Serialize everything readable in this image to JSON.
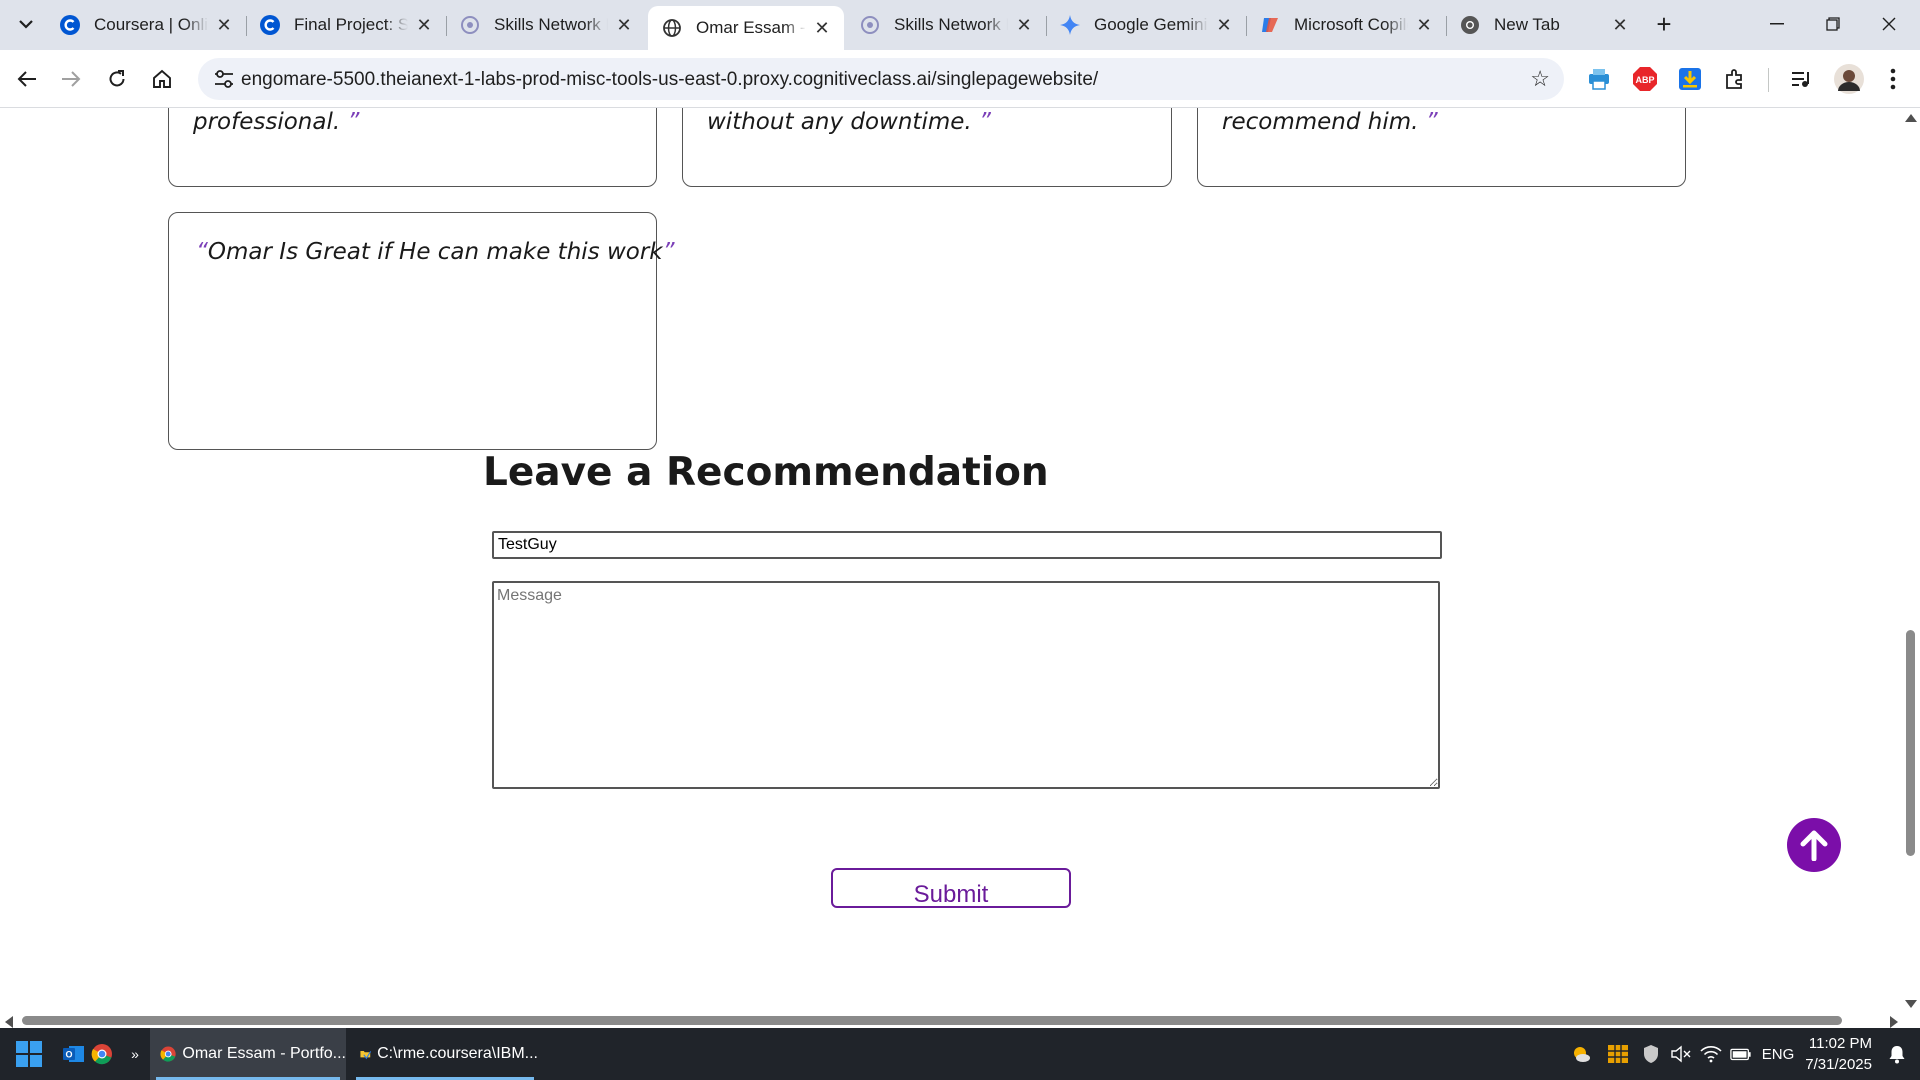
{
  "browser": {
    "tabs": [
      {
        "title": "Coursera | Online Courses",
        "icon": "coursera-icon",
        "active": false
      },
      {
        "title": "Final Project: Submit",
        "icon": "coursera-icon",
        "active": false
      },
      {
        "title": "Skills Network Labs",
        "icon": "skills-network-icon",
        "active": false
      },
      {
        "title": "Omar Essam - Portfolio",
        "icon": "globe-icon",
        "active": true
      },
      {
        "title": "Skills Network Editor",
        "icon": "skills-network-icon",
        "active": false
      },
      {
        "title": "Google Gemini",
        "icon": "gemini-icon",
        "active": false
      },
      {
        "title": "Microsoft Copilot",
        "icon": "copilot-icon",
        "active": false
      },
      {
        "title": "New Tab",
        "icon": "chrome-icon",
        "active": false
      }
    ],
    "url": "engomare-5500.theianext-1-labs-prod-misc-tools-us-east-0.proxy.cognitiveclass.ai/singlepagewebsite/",
    "extensions": [
      "print-extension-icon",
      "adblock-plus-icon",
      "download-extension-icon",
      "extensions-puzzle-icon",
      "media-control-icon",
      "profile-avatar-icon",
      "menu-kebab-icon"
    ]
  },
  "page": {
    "top_quotes": [
      {
        "text": "professional. ",
        "open": "",
        "close": "”"
      },
      {
        "text": "without any downtime. ",
        "open": "",
        "close": "”"
      },
      {
        "text": "recommend him. ",
        "open": "",
        "close": "”"
      }
    ],
    "featured_quote": {
      "open": "“",
      "text": "Omar Is Great if He can make this work",
      "close": "”"
    },
    "section_title": "Leave a Recommendation",
    "form": {
      "name_value": "TestGuy",
      "message_placeholder": "Message",
      "submit_label": "Submit"
    },
    "accent_color": "#7b0ea9"
  },
  "taskbar": {
    "apps": [
      {
        "label": "Omar Essam - Portfo...",
        "icon": "chrome-icon",
        "active": true
      },
      {
        "label": "C:\\rme.coursera\\IBM...",
        "icon": "folder-icon",
        "active": false
      }
    ],
    "language": "ENG",
    "time": "11:02 PM",
    "date": "7/31/2025"
  }
}
